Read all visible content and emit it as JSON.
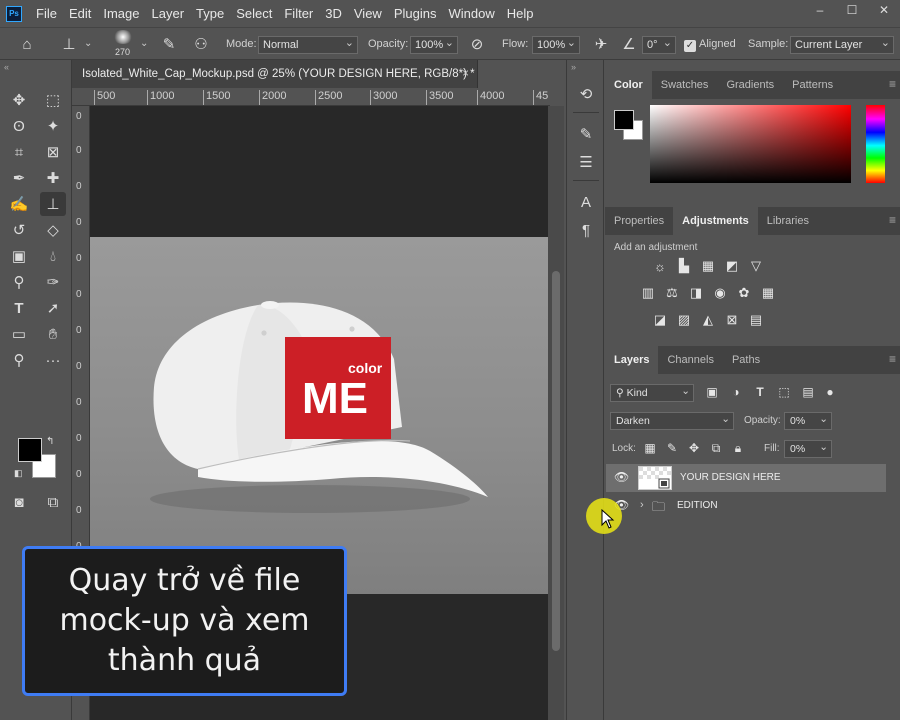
{
  "app": {
    "logo_text": "Ps"
  },
  "menu": [
    "File",
    "Edit",
    "Image",
    "Layer",
    "Type",
    "Select",
    "Filter",
    "3D",
    "View",
    "Plugins",
    "Window",
    "Help"
  ],
  "window_controls": [
    "–",
    "☐",
    "✕"
  ],
  "options_bar": {
    "brush_size": "270",
    "mode_label": "Mode:",
    "mode_value": "Normal",
    "opacity_label": "Opacity:",
    "opacity_value": "100%",
    "flow_label": "Flow:",
    "flow_value": "100%",
    "angle_value": "0°",
    "aligned_label": "Aligned",
    "sample_label": "Sample:",
    "sample_value": "Current Layer"
  },
  "document": {
    "tab_title": "Isolated_White_Cap_Mockup.psd @ 25% (YOUR DESIGN HERE, RGB/8*) *",
    "close_glyph": "×",
    "ruler_ticks": [
      "500",
      "1000",
      "1500",
      "2000",
      "2500",
      "3000",
      "3500",
      "4000",
      "45"
    ],
    "vertical_ruler": [
      "0",
      "0",
      "0",
      "0",
      "0",
      "0",
      "0",
      "0",
      "0",
      "0",
      "0",
      "0",
      "0",
      "0",
      "0",
      "0",
      "0"
    ]
  },
  "logo_on_cap": {
    "small": "color",
    "big": "ME"
  },
  "color_panel": {
    "tabs": [
      "Color",
      "Swatches",
      "Gradients",
      "Patterns"
    ],
    "active": "Color"
  },
  "adjustments_panel": {
    "tabs": [
      "Properties",
      "Adjustments",
      "Libraries"
    ],
    "active": "Adjustments",
    "add_label": "Add an adjustment",
    "icons": [
      "brightness-icon",
      "levels-icon",
      "curves-icon",
      "exposure-icon",
      "vibrance-icon",
      "hue-saturation-icon",
      "color-balance-icon",
      "black-white-icon",
      "photo-filter-icon",
      "channel-mixer-icon",
      "color-lookup-icon",
      "invert-icon",
      "posterize-icon",
      "threshold-icon",
      "selective-color-icon",
      "gradient-map-icon"
    ]
  },
  "layers_panel": {
    "tabs": [
      "Layers",
      "Channels",
      "Paths"
    ],
    "active": "Layers",
    "filter_value": "Kind",
    "blend_mode": "Darken",
    "opacity_label": "Opacity:",
    "opacity_value": "0%",
    "lock_label": "Lock:",
    "fill_label": "Fill:",
    "fill_value": "0%",
    "layers": [
      {
        "name": "YOUR DESIGN HERE",
        "type": "smart-object",
        "selected": true
      },
      {
        "name": "EDITION",
        "type": "group",
        "selected": false
      }
    ]
  },
  "caption": {
    "text": "Quay trở về file\nmock-up và xem\nthành quả"
  }
}
